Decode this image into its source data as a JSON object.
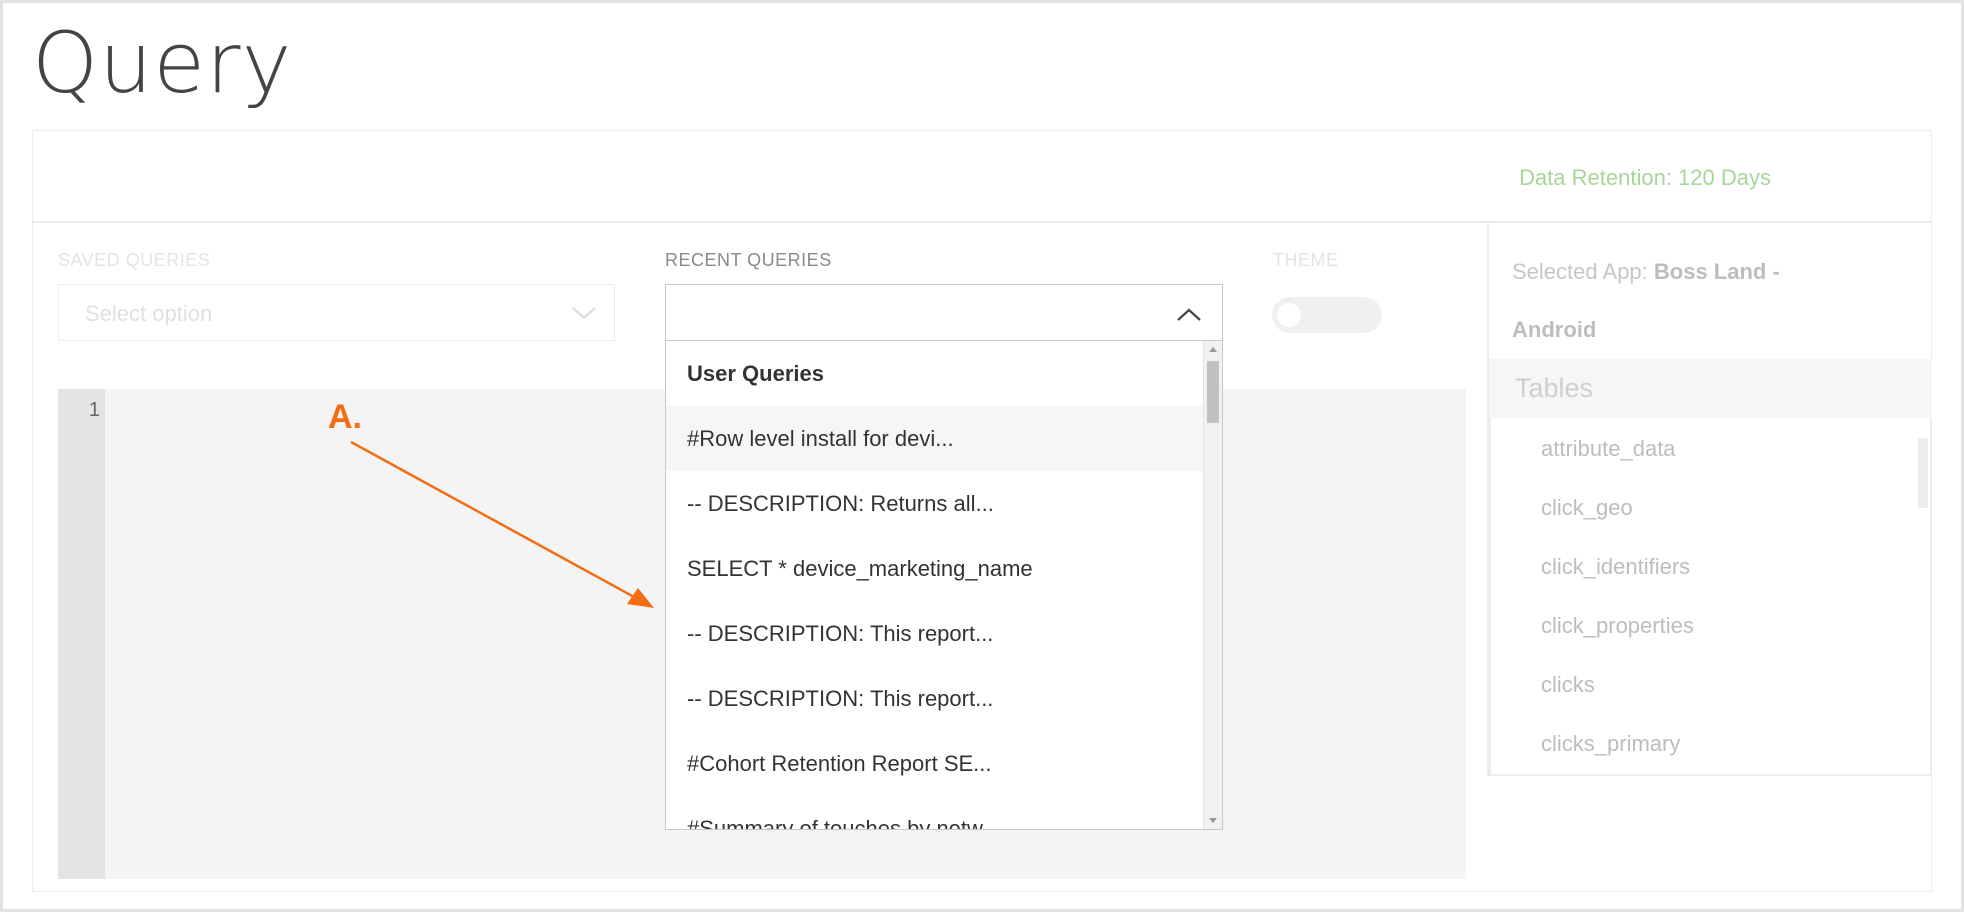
{
  "page": {
    "title": "Query"
  },
  "header": {
    "retention": "Data Retention: 120 Days"
  },
  "saved_queries": {
    "label": "SAVED QUERIES",
    "placeholder": "Select option"
  },
  "recent_queries": {
    "label": "RECENT QUERIES",
    "group_label": "User Queries",
    "items": [
      "#Row level install for devi...",
      "-- DESCRIPTION: Returns all...",
      "SELECT * device_marketing_name",
      "-- DESCRIPTION: This report...",
      "-- DESCRIPTION: This report...",
      "#Cohort Retention Report SE...",
      "#Summary of touches by netw..."
    ]
  },
  "theme": {
    "label": "THEME"
  },
  "editor": {
    "line_number": "1"
  },
  "annotation": {
    "label": "A.",
    "color": "#f46d12"
  },
  "sidebar": {
    "app_prefix": "Selected App: ",
    "app_name": "Boss Land - Android",
    "tables_heading": "Tables",
    "tables": [
      "attribute_data",
      "click_geo",
      "click_identifiers",
      "click_properties",
      "clicks",
      "clicks_primary"
    ]
  },
  "colors": {
    "retention": "#a7d59a",
    "accent": "#f46d12"
  }
}
